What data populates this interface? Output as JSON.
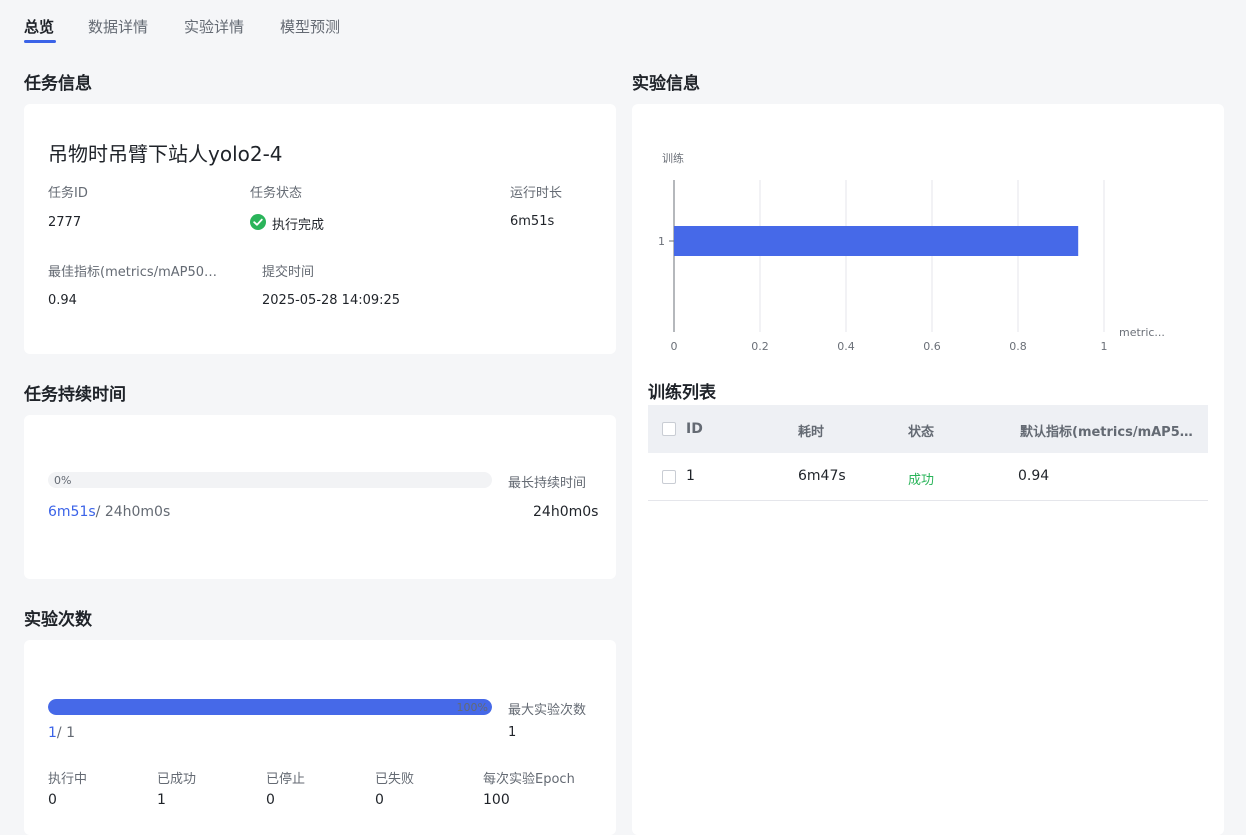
{
  "tabs": [
    "总览",
    "数据详情",
    "实验详情",
    "模型预测"
  ],
  "task_info": {
    "section_title": "任务信息",
    "task_name": "吊物时吊臂下站人yolo2-4",
    "task_id_label": "任务ID",
    "task_id": "2777",
    "status_label": "任务状态",
    "status": "执行完成",
    "runtime_label": "运行时长",
    "runtime": "6m51s",
    "best_metric_label": "最佳指标(metrics/mAP50…",
    "best_metric": "0.94",
    "submit_time_label": "提交时间",
    "submit_time": "2025-05-28 14:09:25"
  },
  "duration": {
    "section_title": "任务持续时间",
    "progress_percent": 0,
    "progress_text": "0%",
    "elapsed": "6m51s",
    "total": "/ 24h0m0s",
    "max_label": "最长持续时间",
    "max_value": "24h0m0s"
  },
  "experiments": {
    "section_title": "实验次数",
    "progress_percent": 100,
    "progress_text": "100%",
    "done": "1",
    "total": "/ 1",
    "max_label": "最大实验次数",
    "max_value": "1",
    "stats": [
      {
        "label": "执行中",
        "value": "0"
      },
      {
        "label": "已成功",
        "value": "1"
      },
      {
        "label": "已停止",
        "value": "0"
      },
      {
        "label": "已失败",
        "value": "0"
      },
      {
        "label": "每次实验Epoch",
        "value": "100"
      }
    ]
  },
  "experiment_info": {
    "section_title": "实验信息"
  },
  "chart_data": {
    "type": "bar",
    "orientation": "horizontal",
    "ylabel": "训练",
    "xlabel": "metric...",
    "categories": [
      "1"
    ],
    "values": [
      0.94
    ],
    "xlim": [
      0,
      1
    ],
    "x_ticks": [
      "0",
      "0.2",
      "0.4",
      "0.6",
      "0.8",
      "1"
    ],
    "grid": true,
    "bar_color": "#4669e8"
  },
  "train_list": {
    "title": "训练列表",
    "columns": [
      "ID",
      "耗时",
      "状态",
      "默认指标(metrics/mAP5…"
    ],
    "rows": [
      {
        "id": "1",
        "time": "6m47s",
        "status": "成功",
        "metric": "0.94"
      }
    ]
  },
  "colors": {
    "accent": "#3b63e8",
    "bar": "#4669e8",
    "success": "#2ab45a"
  }
}
